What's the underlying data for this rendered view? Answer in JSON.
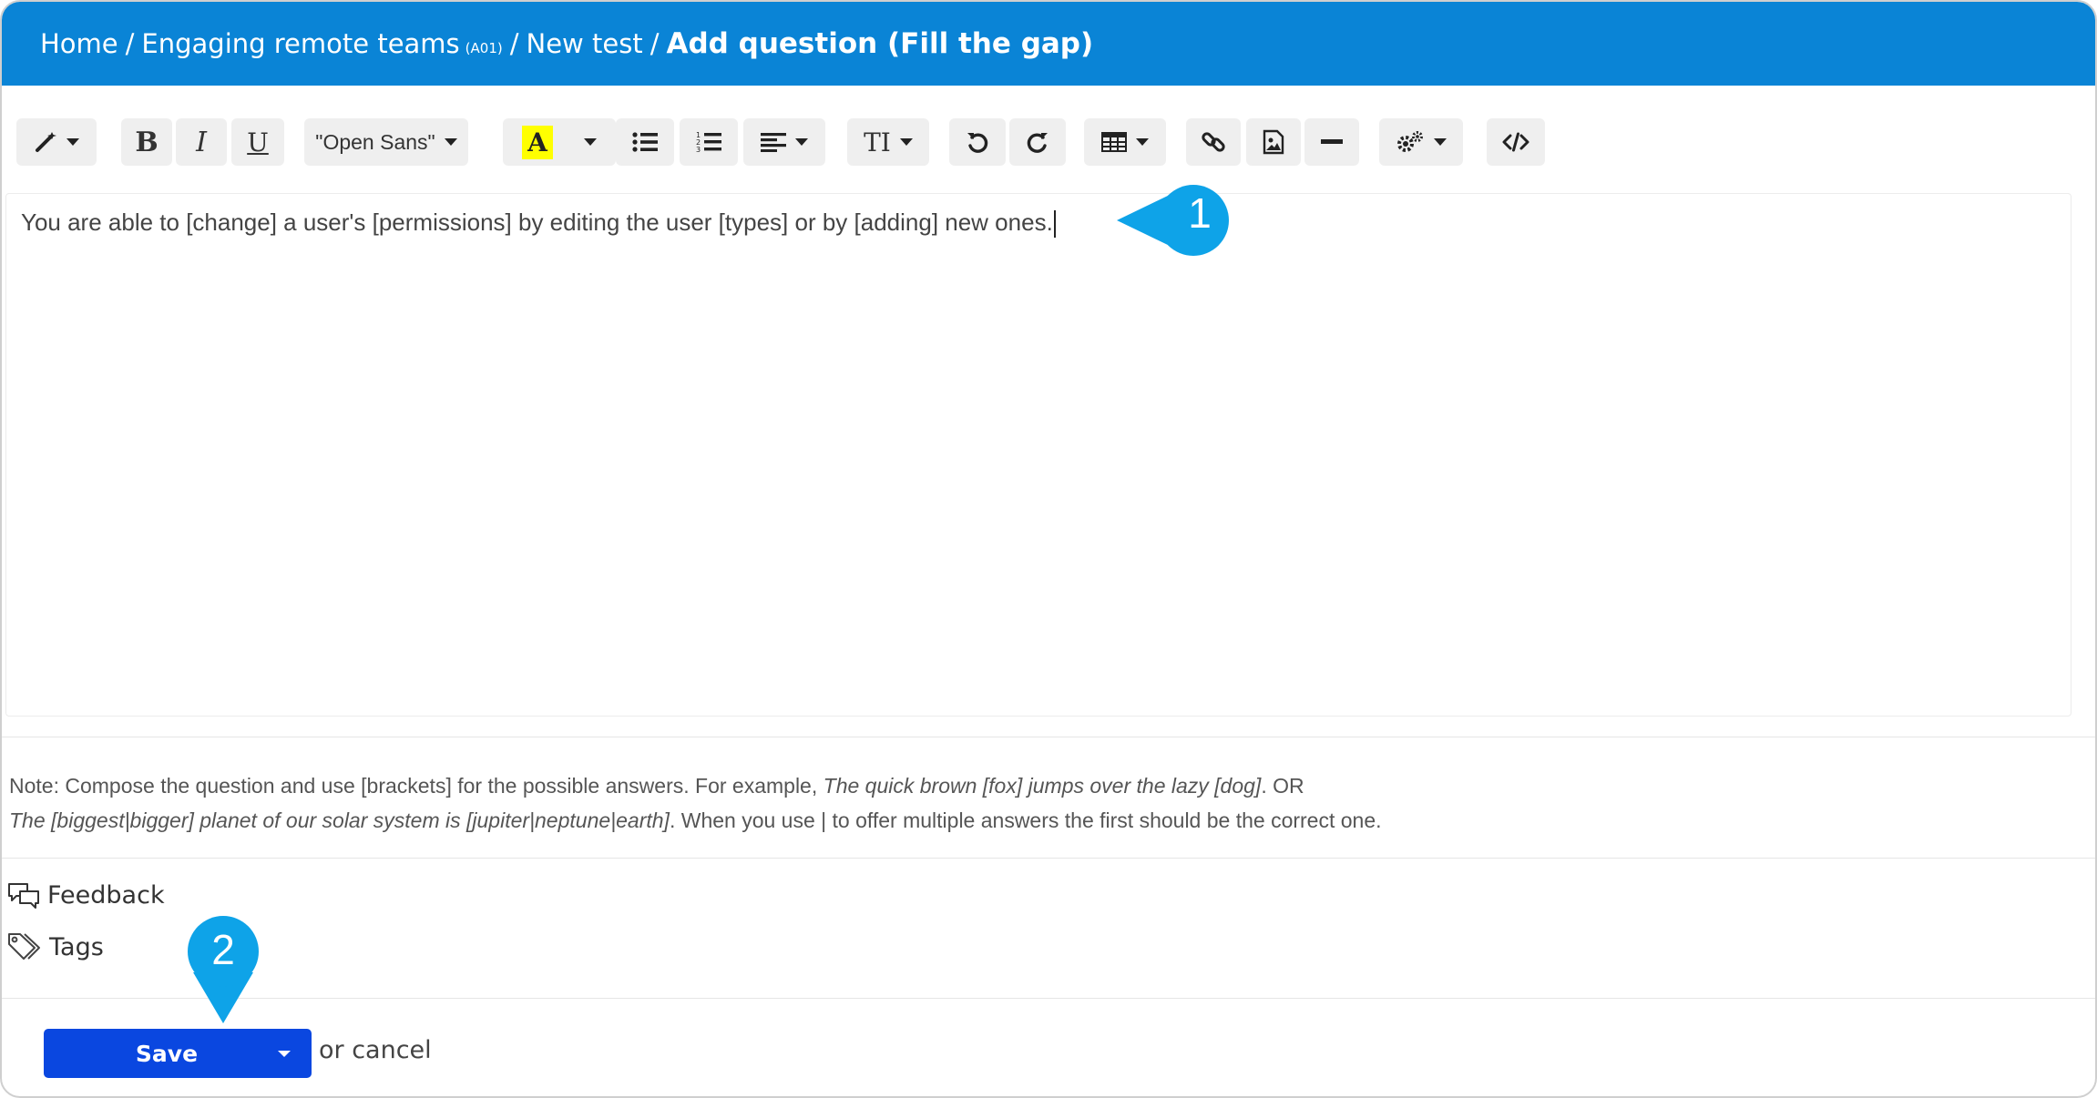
{
  "breadcrumb": {
    "home": "Home",
    "course": "Engaging remote teams",
    "course_code": "(A01)",
    "test": "New test",
    "current": "Add question (Fill the gap)",
    "separator": "/"
  },
  "toolbar": {
    "bold": "B",
    "italic": "I",
    "underline": "U",
    "font": "\"Open Sans\"",
    "highlight": "A",
    "font_size": "TI"
  },
  "editor": {
    "content": "You are able to [change] a user's [permissions] by editing the user [types] or by [adding] new ones."
  },
  "note": {
    "line1_prefix": "Note: Compose the question and use [brackets] for the possible answers. For example, ",
    "line1_example": "The quick brown [fox] jumps over the lazy [dog]",
    "line1_suffix": ". OR",
    "line2_example": "The [biggest|bigger] planet of our solar system is [jupiter|neptune|earth]",
    "line2_suffix": ". When you use | to offer multiple answers the first should be the correct one."
  },
  "sections": {
    "feedback": "Feedback",
    "tags": "Tags"
  },
  "actions": {
    "save": "Save",
    "or_cancel": "or cancel"
  },
  "callouts": {
    "first": "1",
    "second": "2"
  },
  "colors": {
    "header": "#0a84d6",
    "callout": "#0ea3e8",
    "save": "#0a47e0",
    "highlight": "#ffff00"
  }
}
